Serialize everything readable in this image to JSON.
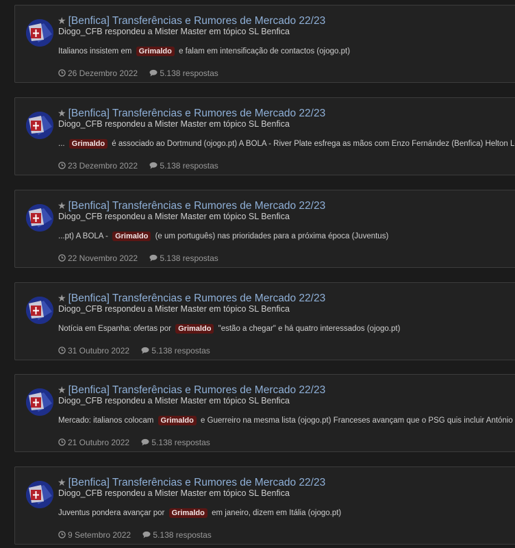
{
  "theme": {
    "accent": "#8fb0d8",
    "highlight_bg": "#5a1614",
    "card_bg": "#222222",
    "page_bg": "#1b1b1b"
  },
  "results": [
    {
      "title": "[Benfica] Transferências e Rumores de Mercado 22/23",
      "byline": "Diogo_CFB respondeu a Mister Master em tópico SL Benfica",
      "snippet_before": "Italianos insistem em",
      "highlight": "Grimaldo",
      "snippet_after": "e falam em intensificação de contactos (ojogo.pt)",
      "date": "26 Dezembro 2022",
      "replies": "5.138 respostas"
    },
    {
      "title": "[Benfica] Transferências e Rumores de Mercado 22/23",
      "byline": "Diogo_CFB respondeu a Mister Master em tópico SL Benfica",
      "snippet_before": "...",
      "highlight": "Grimaldo",
      "snippet_after": "é associado ao Dortmund (ojogo.pt) A BOLA - River Plate esfrega as mãos com Enzo Fernández (Benfica) Helton Leit",
      "date": "23 Dezembro 2022",
      "replies": "5.138 respostas"
    },
    {
      "title": "[Benfica] Transferências e Rumores de Mercado 22/23",
      "byline": "Diogo_CFB respondeu a Mister Master em tópico SL Benfica",
      "snippet_before": "...pt) A BOLA -",
      "highlight": "Grimaldo",
      "snippet_after": "(e um português) nas prioridades para a próxima época (Juventus)",
      "date": "22 Novembro 2022",
      "replies": "5.138 respostas"
    },
    {
      "title": "[Benfica] Transferências e Rumores de Mercado 22/23",
      "byline": "Diogo_CFB respondeu a Mister Master em tópico SL Benfica",
      "snippet_before": "Notícia em Espanha: ofertas por",
      "highlight": "Grimaldo",
      "snippet_after": "\"estão a chegar\" e há quatro interessados (ojogo.pt)",
      "date": "31 Outubro 2022",
      "replies": "5.138 respostas"
    },
    {
      "title": "[Benfica] Transferências e Rumores de Mercado 22/23",
      "byline": "Diogo_CFB respondeu a Mister Master em tópico SL Benfica",
      "snippet_before": "Mercado: italianos colocam",
      "highlight": "Grimaldo",
      "snippet_after": "e Guerreiro na mesma lista (ojogo.pt) Franceses avançam que o PSG quis incluir António S",
      "date": "21 Outubro 2022",
      "replies": "5.138 respostas"
    },
    {
      "title": "[Benfica] Transferências e Rumores de Mercado 22/23",
      "byline": "Diogo_CFB respondeu a Mister Master em tópico SL Benfica",
      "snippet_before": "Juventus pondera avançar por",
      "highlight": "Grimaldo",
      "snippet_after": "em janeiro, dizem em Itália (ojogo.pt)",
      "date": "9 Setembro 2022",
      "replies": "5.138 respostas"
    }
  ]
}
